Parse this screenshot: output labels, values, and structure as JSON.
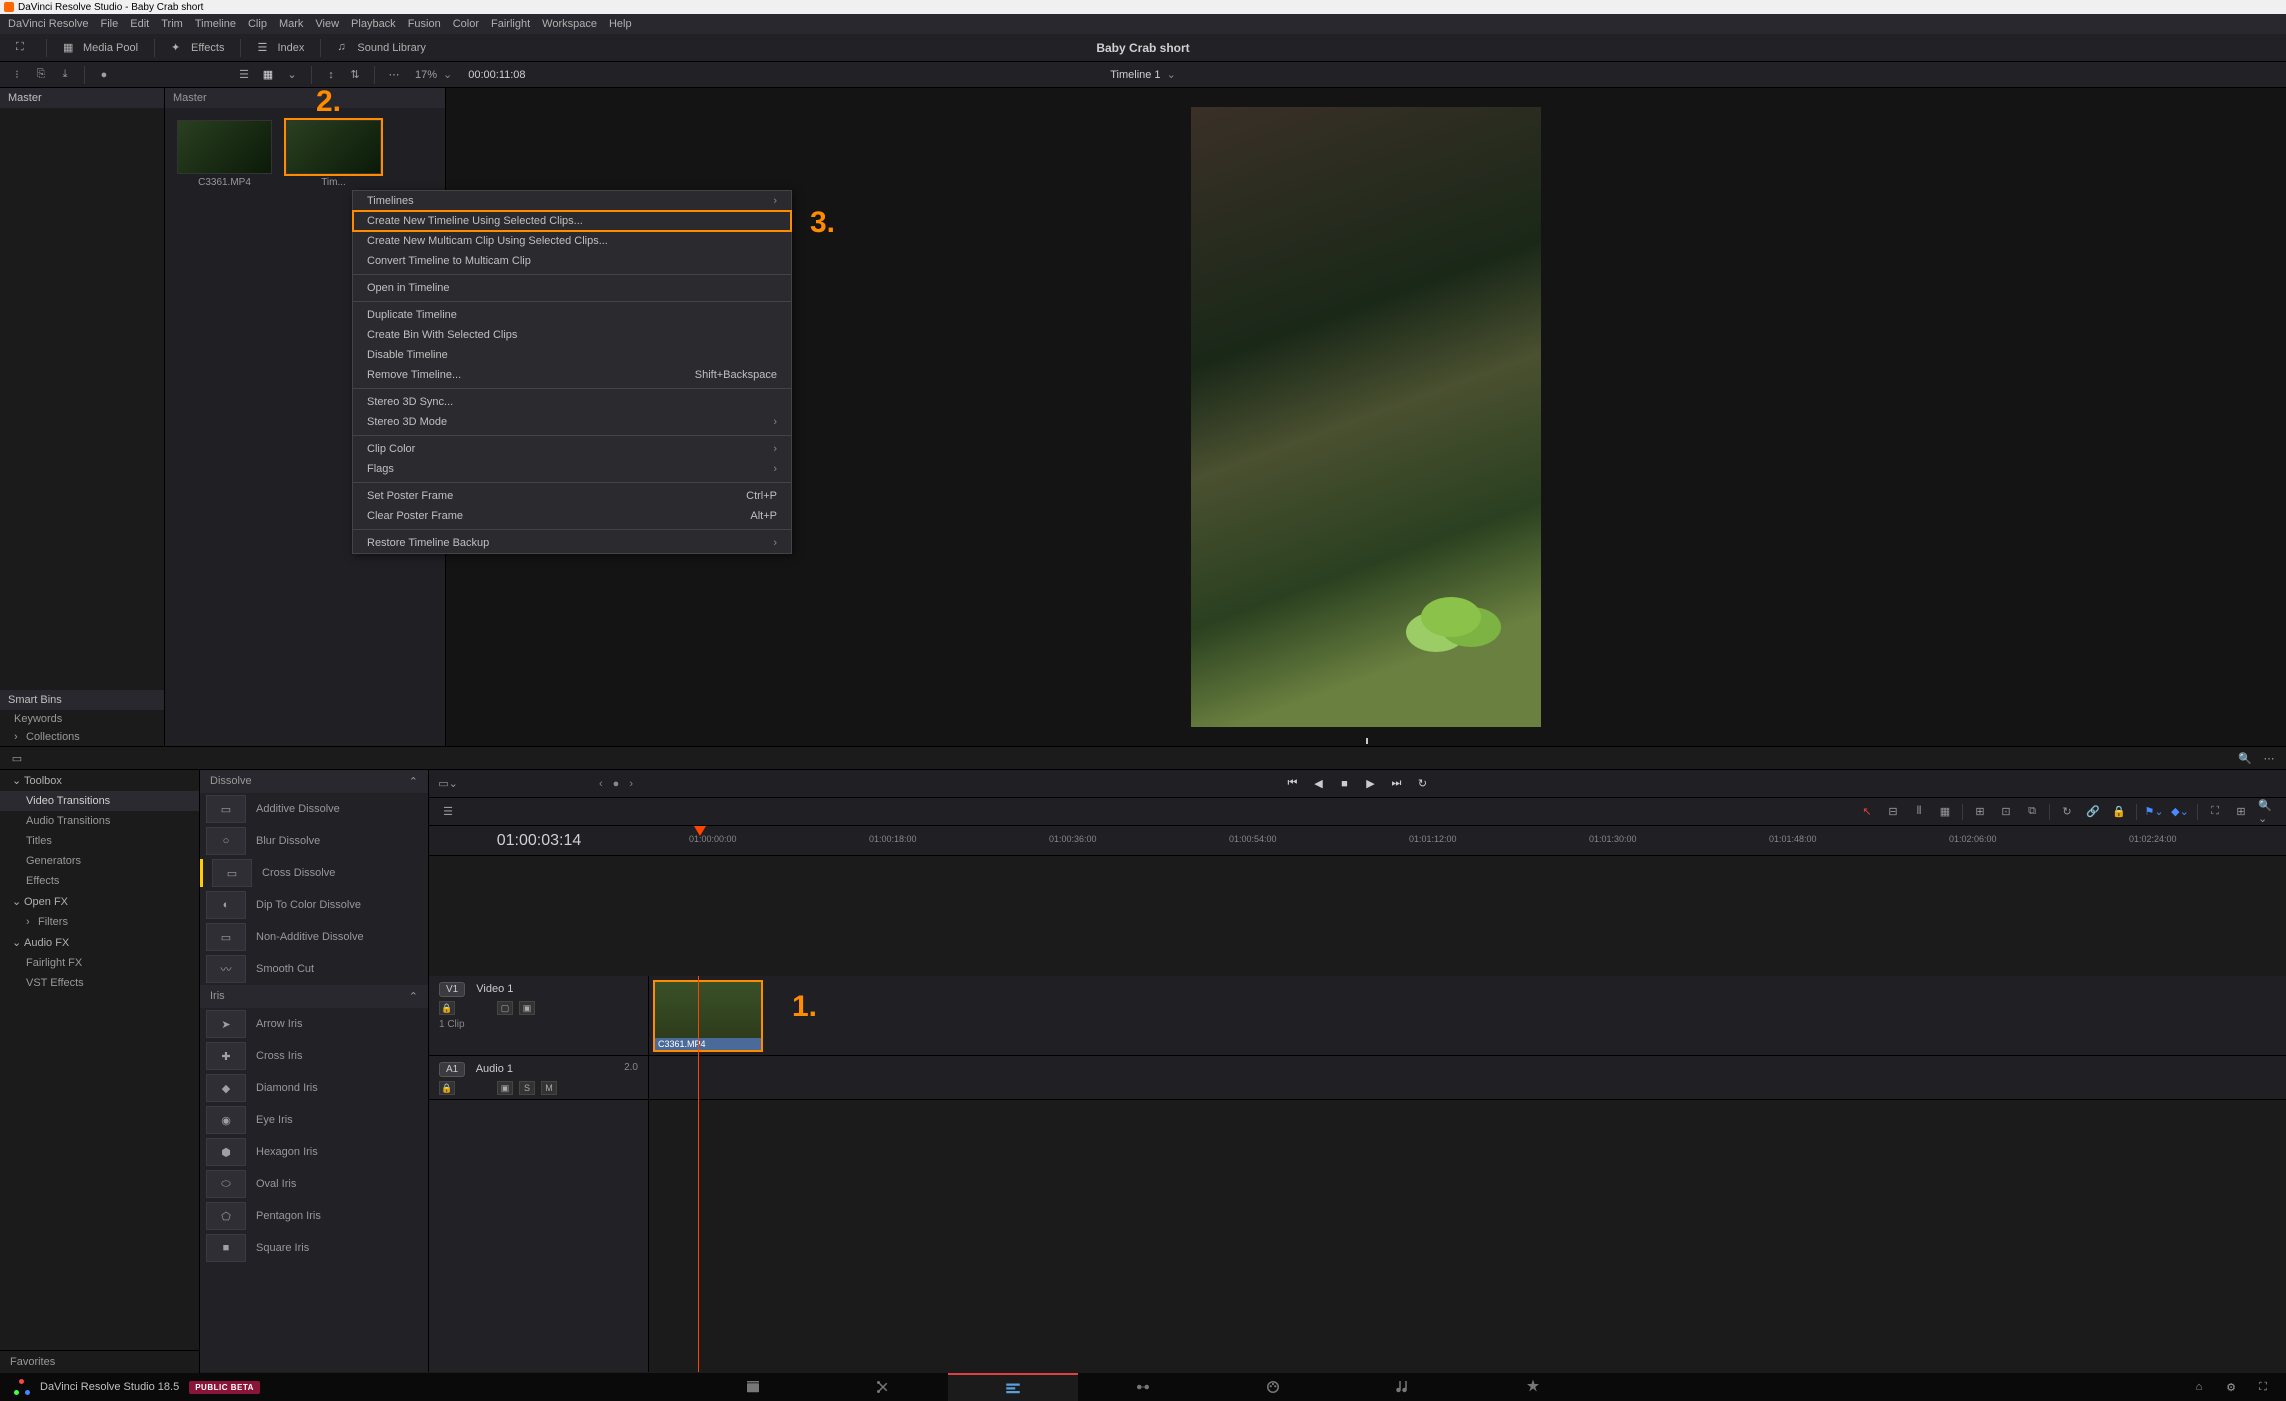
{
  "window_title": "DaVinci Resolve Studio - Baby Crab short",
  "project_name": "Baby Crab short",
  "menubar": [
    "DaVinci Resolve",
    "File",
    "Edit",
    "Trim",
    "Timeline",
    "Clip",
    "Mark",
    "View",
    "Playback",
    "Fusion",
    "Color",
    "Fairlight",
    "Workspace",
    "Help"
  ],
  "toolbar": {
    "media_pool": "Media Pool",
    "effects": "Effects",
    "index": "Index",
    "sound_library": "Sound Library"
  },
  "sub_toolbar": {
    "zoom": "17%",
    "timecode": "00:00:11:08",
    "timeline_name": "Timeline 1"
  },
  "bins": {
    "left_header": "Master",
    "media_header": "Master",
    "smart_bins_header": "Smart Bins",
    "smart_bins": [
      "Keywords",
      "Collections"
    ]
  },
  "clips": [
    {
      "label": "C3361.MP4"
    },
    {
      "label": "Tim..."
    }
  ],
  "context_menu": {
    "groups": [
      [
        {
          "label": "Timelines",
          "arrow": true
        },
        {
          "label": "Create New Timeline Using Selected Clips...",
          "highlight": true
        },
        {
          "label": "Create New Multicam Clip Using Selected Clips..."
        },
        {
          "label": "Convert Timeline to Multicam Clip"
        }
      ],
      [
        {
          "label": "Open in Timeline"
        }
      ],
      [
        {
          "label": "Duplicate Timeline"
        },
        {
          "label": "Create Bin With Selected Clips"
        },
        {
          "label": "Disable Timeline"
        },
        {
          "label": "Remove Timeline...",
          "shortcut": "Shift+Backspace"
        }
      ],
      [
        {
          "label": "Stereo 3D Sync..."
        },
        {
          "label": "Stereo 3D Mode",
          "arrow": true
        }
      ],
      [
        {
          "label": "Clip Color",
          "arrow": true
        },
        {
          "label": "Flags",
          "arrow": true
        }
      ],
      [
        {
          "label": "Set Poster Frame",
          "shortcut": "Ctrl+P"
        },
        {
          "label": "Clear Poster Frame",
          "shortcut": "Alt+P"
        }
      ],
      [
        {
          "label": "Restore Timeline Backup",
          "arrow": true
        }
      ]
    ]
  },
  "effects_nav": {
    "toolbox": "Toolbox",
    "toolbox_items": [
      "Video Transitions",
      "Audio Transitions",
      "Titles",
      "Generators",
      "Effects"
    ],
    "openfx": "Open FX",
    "openfx_items": [
      "Filters"
    ],
    "audiofx": "Audio FX",
    "audiofx_items": [
      "Fairlight FX",
      "VST Effects"
    ]
  },
  "effects_groups": [
    {
      "header": "Dissolve",
      "items": [
        "Additive Dissolve",
        "Blur Dissolve",
        "Cross Dissolve",
        "Dip To Color Dissolve",
        "Non-Additive Dissolve",
        "Smooth Cut"
      ]
    },
    {
      "header": "Iris",
      "items": [
        "Arrow Iris",
        "Cross Iris",
        "Diamond Iris",
        "Eye Iris",
        "Hexagon Iris",
        "Oval Iris",
        "Pentagon Iris",
        "Square Iris"
      ]
    }
  ],
  "timeline": {
    "current_tc": "01:00:03:14",
    "ruler": [
      "01:00:00:00",
      "01:00:18:00",
      "01:00:36:00",
      "01:00:54:00",
      "01:01:12:00",
      "01:01:30:00",
      "01:01:48:00",
      "01:02:06:00",
      "01:02:24:00"
    ],
    "video_track": {
      "badge": "V1",
      "name": "Video 1",
      "sub": "1 Clip"
    },
    "audio_track": {
      "badge": "A1",
      "name": "Audio 1",
      "level": "2.0"
    },
    "clip_name": "C3361.MP4"
  },
  "footer": {
    "version": "DaVinci Resolve Studio 18.5",
    "badge": "PUBLIC BETA",
    "favorites": "Favorites"
  },
  "callouts": {
    "c1": "1.",
    "c2": "2.",
    "c3": "3."
  }
}
